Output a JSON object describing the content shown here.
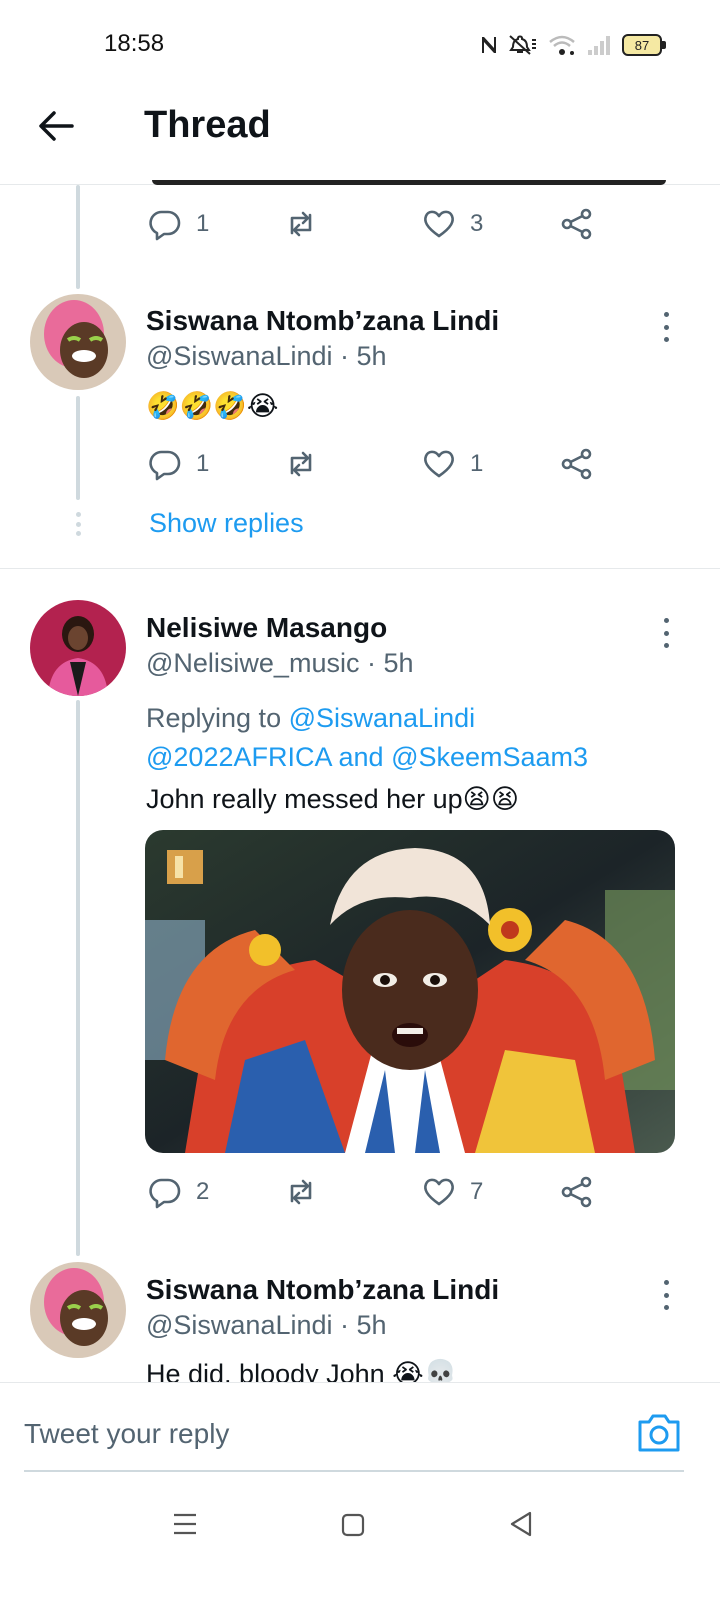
{
  "status_bar": {
    "time": "18:58",
    "battery": "87",
    "icons": [
      "nfc-icon",
      "mute-icon",
      "wifi-icon",
      "signal-icon",
      "battery-icon"
    ]
  },
  "header": {
    "title": "Thread",
    "back_icon": "arrow-left-icon"
  },
  "tweets": [
    {
      "actions": {
        "replies": "1",
        "likes": "3"
      }
    },
    {
      "name": "Siswana Ntomb’zana Lindi",
      "handle": "@SiswanaLindi · 5h",
      "text": "🤣🤣🤣😭",
      "actions": {
        "replies": "1",
        "likes": "1"
      },
      "show_replies": "Show replies"
    },
    {
      "name": "Nelisiwe Masango",
      "handle": "@Nelisiwe_music · 5h",
      "replying_prefix": "Replying to ",
      "replying_user1": "@SiswanaLindi",
      "replying_user2": "@2022AFRICA",
      "replying_and": " and ",
      "replying_user3": "@SkeemSaam3",
      "text": "John really messed her up😫😫",
      "actions": {
        "replies": "2",
        "likes": "7"
      }
    },
    {
      "name": "Siswana Ntomb’zana Lindi",
      "handle": "@SiswanaLindi · 5h",
      "text": "He did, bloody John 😭💀"
    }
  ],
  "reply_box": {
    "placeholder": "Tweet your reply",
    "camera_icon": "camera-icon"
  },
  "nav_bar": {
    "icons": [
      "menu-icon",
      "home-square-icon",
      "back-triangle-icon"
    ]
  },
  "colors": {
    "accent": "#1d9bf0",
    "text": "#0f1419",
    "muted": "#536471",
    "divider": "#e6e9eb",
    "thread_line": "#cfd9de"
  }
}
